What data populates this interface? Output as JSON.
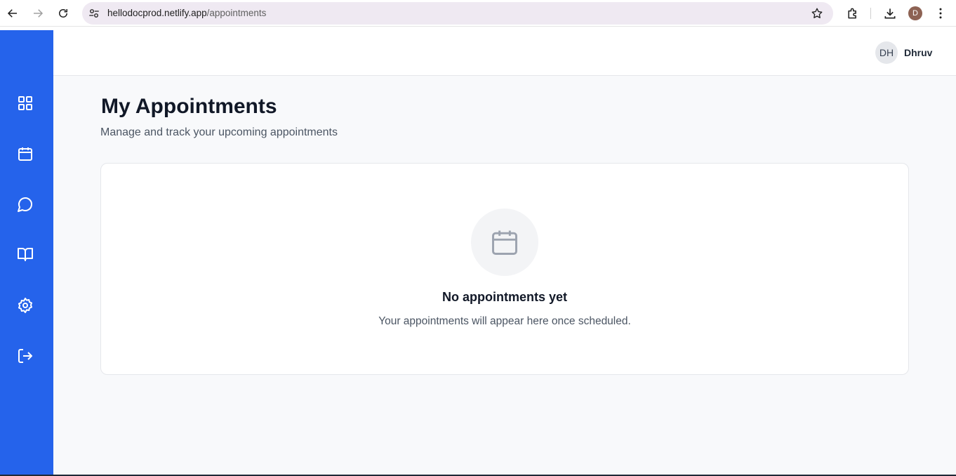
{
  "browser": {
    "url_host": "hellodocprod.netlify.app",
    "url_path": "/appointments",
    "profile_initial": "D"
  },
  "sidebar": {
    "items": [
      {
        "name": "dashboard",
        "icon": "grid-icon"
      },
      {
        "name": "appointments",
        "icon": "calendar-icon"
      },
      {
        "name": "messages",
        "icon": "chat-icon"
      },
      {
        "name": "resources",
        "icon": "book-icon"
      },
      {
        "name": "settings",
        "icon": "gear-icon"
      },
      {
        "name": "logout",
        "icon": "logout-icon"
      }
    ],
    "color": "#2563eb"
  },
  "header": {
    "avatar_initials": "DH",
    "user_name": "Dhruv"
  },
  "main": {
    "title": "My Appointments",
    "subtitle": "Manage and track your upcoming appointments",
    "empty_state": {
      "icon": "calendar-icon",
      "title": "No appointments yet",
      "text": "Your appointments will appear here once scheduled."
    }
  }
}
